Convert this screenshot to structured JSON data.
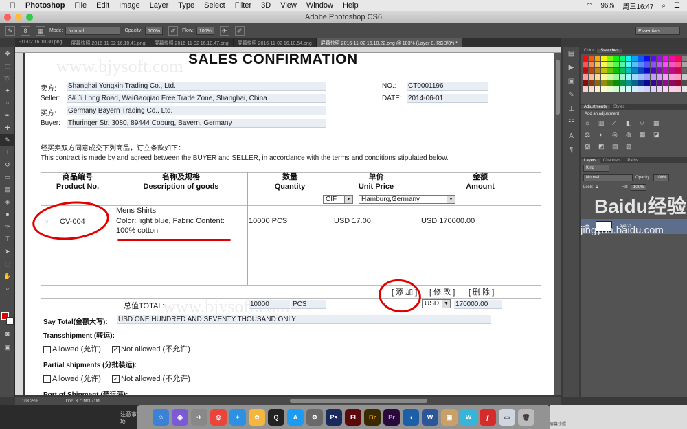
{
  "menubar": {
    "apple": "",
    "app": "Photoshop",
    "items": [
      "File",
      "Edit",
      "Image",
      "Layer",
      "Type",
      "Select",
      "Filter",
      "3D",
      "View",
      "Window",
      "Help"
    ],
    "battery": "96%",
    "clock": "周三16:47"
  },
  "window": {
    "title": "Adobe Photoshop CS6",
    "colors": {
      "close": "#fc605c",
      "min": "#fdbc40",
      "max": "#34c84a"
    }
  },
  "options": {
    "mode_label": "Mode:",
    "mode_value": "Normal",
    "opacity_label": "Opacity:",
    "opacity_value": "100%",
    "flow_label": "Flow:",
    "flow_value": "100%",
    "workspace": "Essentials",
    "brush_size": "8"
  },
  "tabs": [
    "-11-02 16.10.30.png",
    "屏幕快照 2016-11-02 16.10.41.png",
    "屏幕快照 2016-11-02 16.10.47.png",
    "屏幕快照 2016-11-02 16.10.54.png",
    "屏幕快照 2016-11-02 16.10.22.png @ 103% (Layer 0, RGB/8*) *"
  ],
  "status": {
    "zoom": "103.25%",
    "doc": "Doc: 3.71M/3.71M"
  },
  "panels": {
    "color_tab": "Color",
    "swatches_tab": "Swatches",
    "adjustments_tab": "Adjustments",
    "styles_tab": "Styles",
    "add_adjustment": "Add an adjustment",
    "layers_tab": "Layers",
    "channels_tab": "Channels",
    "paths_tab": "Paths",
    "kind": "Kind",
    "blend": "Normal",
    "opacity_label": "Opacity:",
    "opacity_value": "100%",
    "lock_label": "Lock:",
    "fill_label": "Fill:",
    "fill_value": "100%",
    "layer_name": "Layer 0"
  },
  "document": {
    "watermark": "www.bjysoft.com",
    "title": "SALES CONFIRMATION",
    "seller_cn": "卖方:",
    "seller_cn_value": "Shanghai Yongxin Trading Co., Ltd.",
    "seller_label": "Seller:",
    "seller_address": "8# Ji Long Road, WaiGaoqiao Free Trade Zone, Shanghai, China",
    "buyer_cn": "买方:",
    "buyer_cn_value": "Germany Bayern Trading Co., Ltd.",
    "buyer_label": "Buyer:",
    "buyer_address": "Thuringer Str. 3080, 89444 Coburg, Bayern, Germany",
    "no_label": "NO.:",
    "no_value": "CT0001196",
    "date_label": "DATE:",
    "date_value": "2014-06-01",
    "intro_cn": "经买卖双方同意成交下列商品，订立条款如下：",
    "intro_en": "This contract is made by and agreed between the BUYER and SELLER, in accordance with the terms and conditions stipulated below.",
    "col_product_cn": "商品编号",
    "col_product": "Product No.",
    "col_desc_cn": "名称及规格",
    "col_desc": "Description of goods",
    "col_qty_cn": "数量",
    "col_qty": "Quantity",
    "col_price_cn": "单价",
    "col_price": "Unit Price",
    "col_amount_cn": "金额",
    "col_amount": "Amount",
    "term": "CIF",
    "port": "Hamburg,Germany",
    "product_no": "CV-004",
    "desc_line1": "Mens Shirts",
    "desc_line2": "Color: light blue, Fabric Content:",
    "desc_line3": "100% cotton",
    "quantity": "10000 PCS",
    "unit_price": "USD 17.00",
    "amount": "USD 170000.00",
    "btn_add": "[ 添 加 ]",
    "btn_edit": "[ 修 改 ]",
    "btn_delete": "[ 删 除 ]",
    "total_label": "总值TOTAL:",
    "total_qty": "10000",
    "total_unit": "PCS",
    "total_currency": "USD",
    "total_amount": "170000.00",
    "say_total_label": "Say Total(金额大写):",
    "say_total_value": "USD ONE HUNDRED AND SEVENTY THOUSAND ONLY",
    "transshipment": "Transshipment (转运):",
    "allowed": "Allowed (允许)",
    "not_allowed": "Not allowed (不允许)",
    "partial": "Partial shipments (分批装运):",
    "port_shipment": "Port of Shipment (装运港):"
  },
  "desktop": {
    "note": "注意事项",
    "screenshot_label": "屏幕快照"
  },
  "overlay_watermark": {
    "brand": "Baidu经验",
    "url": "jingyan.baidu.com"
  }
}
